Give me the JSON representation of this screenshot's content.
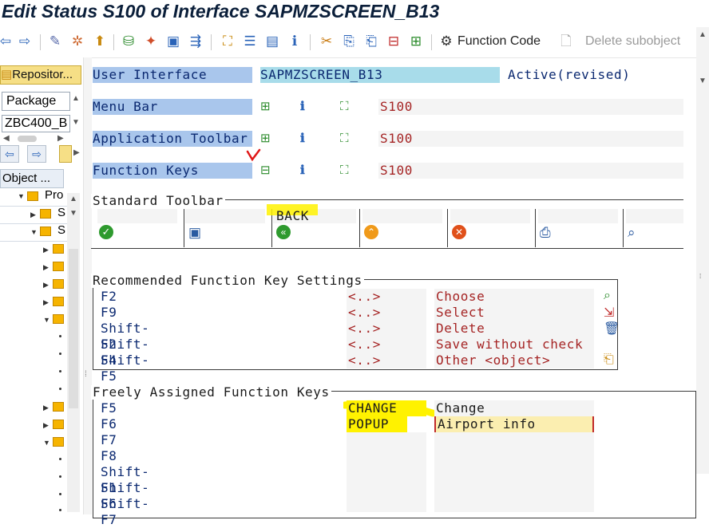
{
  "window": {
    "title": "Edit Status S100 of Interface SAPMZSCREEN_B13"
  },
  "toolbar": {
    "function_code_label": "Function Code",
    "delete_subobject_label": "Delete subobject"
  },
  "left_panel": {
    "repository_button": "Repositor...",
    "package_label": "Package",
    "package_value": "ZBC400_B",
    "object_header": "Object ...",
    "tree_root": "Pro",
    "tree_item_1": "S",
    "tree_item_2": "S"
  },
  "main": {
    "user_interface": {
      "label": "User Interface",
      "value": "SAPMZSCREEN_B13",
      "status": "Active(revised)"
    },
    "menu_bar": {
      "label": "Menu Bar",
      "value": "S100"
    },
    "application_toolbar": {
      "label": "Application Toolbar",
      "value": "S100"
    },
    "function_keys": {
      "label": "Function Keys",
      "value": "S100"
    },
    "standard_toolbar": {
      "title": "Standard Toolbar",
      "back_code": "BACK",
      "icons": [
        "check-icon",
        "save-icon",
        "back-icon",
        "exit-icon",
        "cancel-icon",
        "print-icon",
        "find-icon"
      ]
    },
    "recommended": {
      "title": "Recommended Function Key Settings",
      "rows": [
        {
          "key": "F2",
          "code": "<..>",
          "text": "Choose"
        },
        {
          "key": "F9",
          "code": "<..>",
          "text": "Select"
        },
        {
          "key": "Shift-F2",
          "code": "<..>",
          "text": "Delete"
        },
        {
          "key": "Shift-F4",
          "code": "<..>",
          "text": "Save without check"
        },
        {
          "key": "Shift-F5",
          "code": "<..>",
          "text": "Other <object>"
        }
      ]
    },
    "freely": {
      "title": "Freely Assigned Function Keys",
      "rows": [
        {
          "key": "F5",
          "code": "CHANGE",
          "text": "Change"
        },
        {
          "key": "F6",
          "code": "POPUP",
          "text": "Airport info"
        },
        {
          "key": "F7",
          "code": "",
          "text": ""
        },
        {
          "key": "F8",
          "code": "",
          "text": ""
        },
        {
          "key": "Shift-F1",
          "code": "",
          "text": ""
        },
        {
          "key": "Shift-F6",
          "code": "",
          "text": ""
        },
        {
          "key": "Shift-F7",
          "code": "",
          "text": ""
        }
      ]
    }
  },
  "colors": {
    "label_bg": "#a9c6ec",
    "value_bg": "#a8dcea",
    "highlight": "#fff200",
    "status_red": "#a52424",
    "label_blue": "#0a2870"
  }
}
